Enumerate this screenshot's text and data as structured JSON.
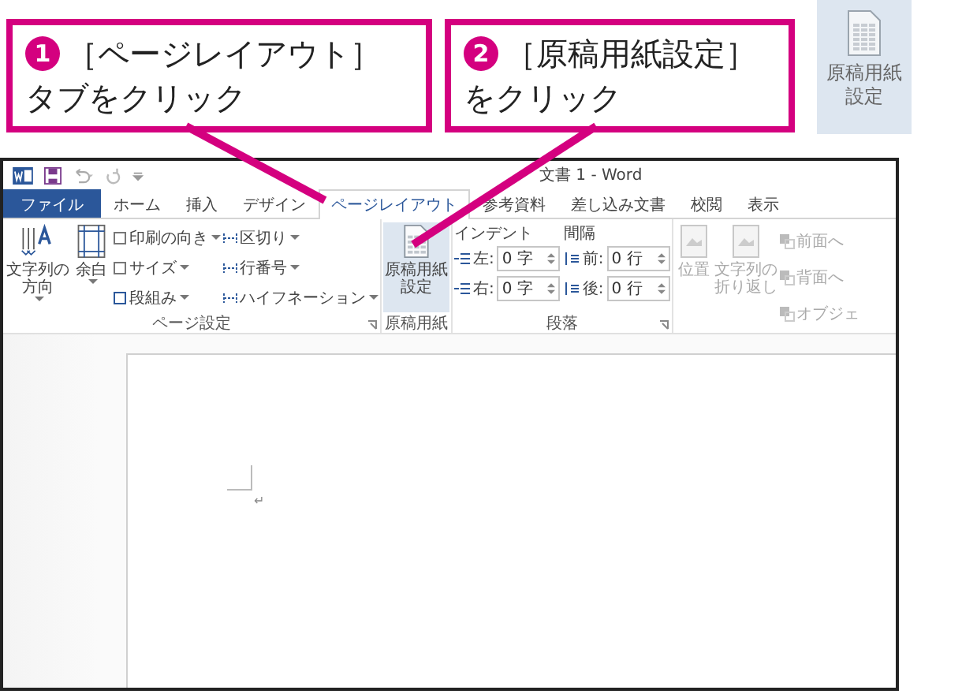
{
  "callouts": [
    {
      "number": "1",
      "lines": [
        "［ページレイアウト］",
        "タブをクリック"
      ]
    },
    {
      "number": "2",
      "lines": [
        "［原稿用紙設定］",
        "をクリック"
      ]
    }
  ],
  "zoom_button": {
    "lines": [
      "原稿用紙",
      "設定"
    ]
  },
  "window": {
    "title": "文書 1 - Word"
  },
  "tabs": [
    {
      "label": "ファイル",
      "kind": "file",
      "selected": false
    },
    {
      "label": "ホーム",
      "kind": "tab",
      "selected": false
    },
    {
      "label": "挿入",
      "kind": "tab",
      "selected": false
    },
    {
      "label": "デザイン",
      "kind": "tab",
      "selected": false
    },
    {
      "label": "ページレイアウト",
      "kind": "tab",
      "selected": true
    },
    {
      "label": "参考資料",
      "kind": "tab",
      "selected": false
    },
    {
      "label": "差し込み文書",
      "kind": "tab",
      "selected": false
    },
    {
      "label": "校閲",
      "kind": "tab",
      "selected": false
    },
    {
      "label": "表示",
      "kind": "tab",
      "selected": false
    }
  ],
  "page_setup": {
    "label": "ページ設定",
    "large_buttons": [
      {
        "lines": [
          "文字列の",
          "方向"
        ]
      },
      {
        "lines": [
          "余白"
        ]
      }
    ],
    "small_buttons": [
      "印刷の向き",
      "サイズ",
      "段組み",
      "区切り",
      "行番号",
      "ハイフネーション"
    ]
  },
  "manuscript": {
    "label": "原稿用紙",
    "button": {
      "lines": [
        "原稿用紙",
        "設定"
      ],
      "highlighted": true
    }
  },
  "paragraph": {
    "label": "段落",
    "indent_title": "インデント",
    "spacing_title": "間隔",
    "indent": [
      {
        "label": "左:",
        "value": "0 字"
      },
      {
        "label": "右:",
        "value": "0 字"
      }
    ],
    "spacing": [
      {
        "label": "前:",
        "value": "0 行"
      },
      {
        "label": "後:",
        "value": "0 行"
      }
    ]
  },
  "arrange": {
    "disabled": true,
    "large_buttons": [
      {
        "lines": [
          "位置"
        ]
      },
      {
        "lines": [
          "文字列の",
          "折り返し"
        ]
      }
    ],
    "small_buttons": [
      "前面へ",
      "背面へ",
      "オブジェ"
    ]
  },
  "document": {
    "paragraph_mark": "↵"
  }
}
